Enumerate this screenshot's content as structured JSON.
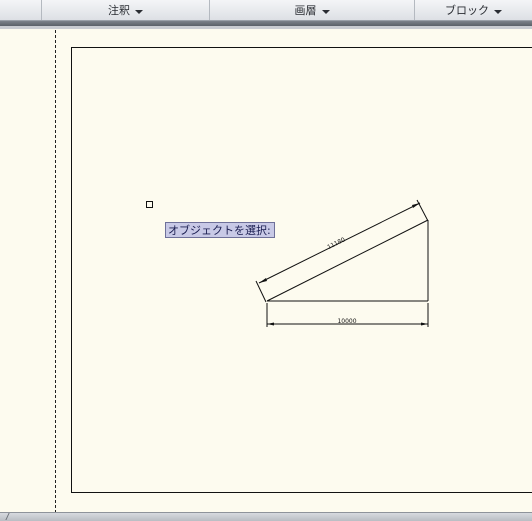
{
  "ribbon": {
    "panels": [
      {
        "label": ""
      },
      {
        "label": "注釈"
      },
      {
        "label": "画層"
      },
      {
        "label": "ブロック"
      }
    ]
  },
  "drawing": {
    "dimension_sloped": "11180",
    "dimension_base": "10000"
  },
  "cursor_prompt": {
    "text": "オブジェクトを選択:"
  },
  "colors": {
    "background": "#fdfbef",
    "linework": "#1a1a1a",
    "prompt_fill": "#c8c9e6"
  }
}
